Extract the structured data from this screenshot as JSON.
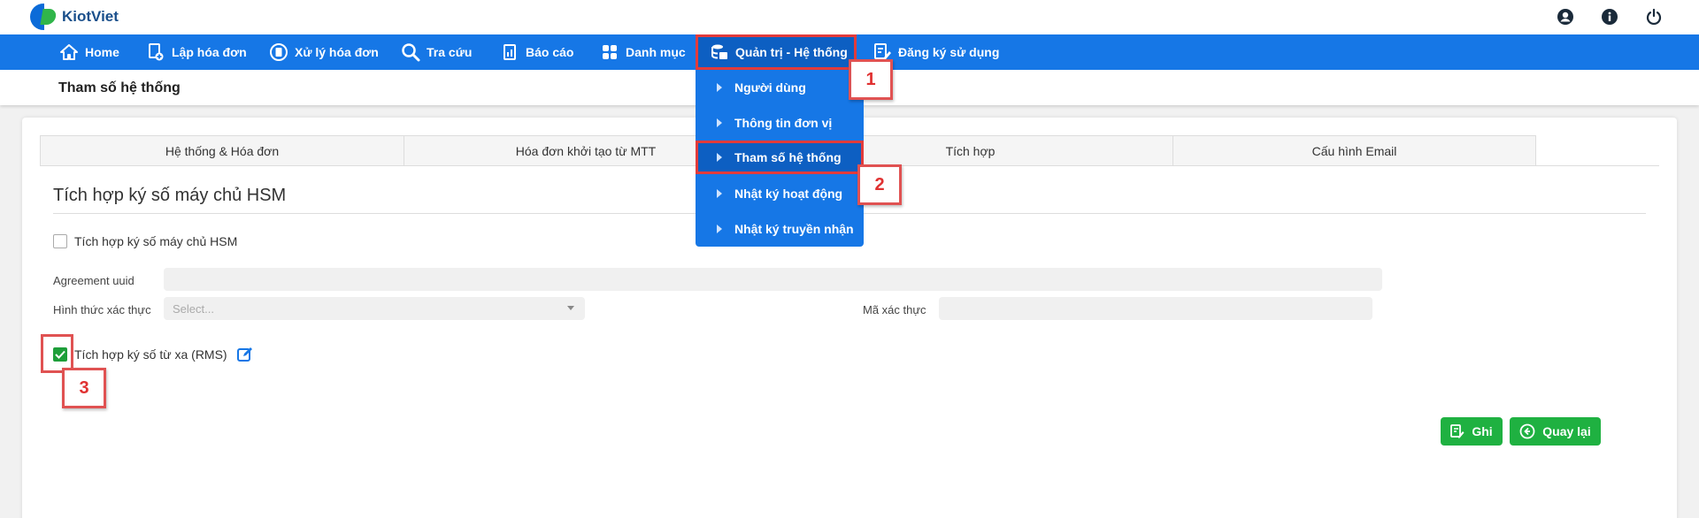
{
  "app": {
    "name": "KiotViet"
  },
  "nav": {
    "items": [
      {
        "label": "Home",
        "icon": "home-icon"
      },
      {
        "label": "Lập hóa đơn",
        "icon": "invoice-add-icon"
      },
      {
        "label": "Xử lý hóa đơn",
        "icon": "invoice-process-icon"
      },
      {
        "label": "Tra cứu",
        "icon": "search-icon"
      },
      {
        "label": "Báo cáo",
        "icon": "report-icon"
      },
      {
        "label": "Danh mục",
        "icon": "grid-icon"
      },
      {
        "label": "Quản trị - Hệ thống",
        "icon": "database-icon",
        "active": true
      },
      {
        "label": "Đăng ký sử dụng",
        "icon": "edit-document-icon"
      }
    ]
  },
  "dropdown": {
    "items": [
      {
        "label": "Người dùng"
      },
      {
        "label": "Thông tin đơn vị"
      },
      {
        "label": "Tham số hệ thống",
        "active": true
      },
      {
        "label": "Nhật ký hoạt động"
      },
      {
        "label": "Nhật ký truyền nhận"
      }
    ]
  },
  "page": {
    "title": "Tham số hệ thống"
  },
  "tabs": [
    {
      "label": "Hệ thống & Hóa đơn"
    },
    {
      "label": "Hóa đơn khởi tạo từ MTT"
    },
    {
      "label": "Tích hợp"
    },
    {
      "label": "Cấu hình Email"
    }
  ],
  "section": {
    "title": "Tích hợp ký số máy chủ HSM"
  },
  "form": {
    "hsm_checkbox_label": "Tích hợp ký số máy chủ HSM",
    "hsm_checked": false,
    "agreement_label": "Agreement uuid",
    "agreement_value": "",
    "auth_method_label": "Hình thức xác thực",
    "auth_method_placeholder": "Select...",
    "auth_code_label": "Mã xác thực",
    "auth_code_value": "",
    "rms_checkbox_label": "Tích hợp ký số từ xa (RMS)",
    "rms_checked": true
  },
  "buttons": {
    "save": "Ghi",
    "back": "Quay lại"
  },
  "callouts": [
    "1",
    "2",
    "3"
  ],
  "colors": {
    "primary": "#1677e6",
    "success": "#1fb141",
    "highlight": "#e05252"
  }
}
